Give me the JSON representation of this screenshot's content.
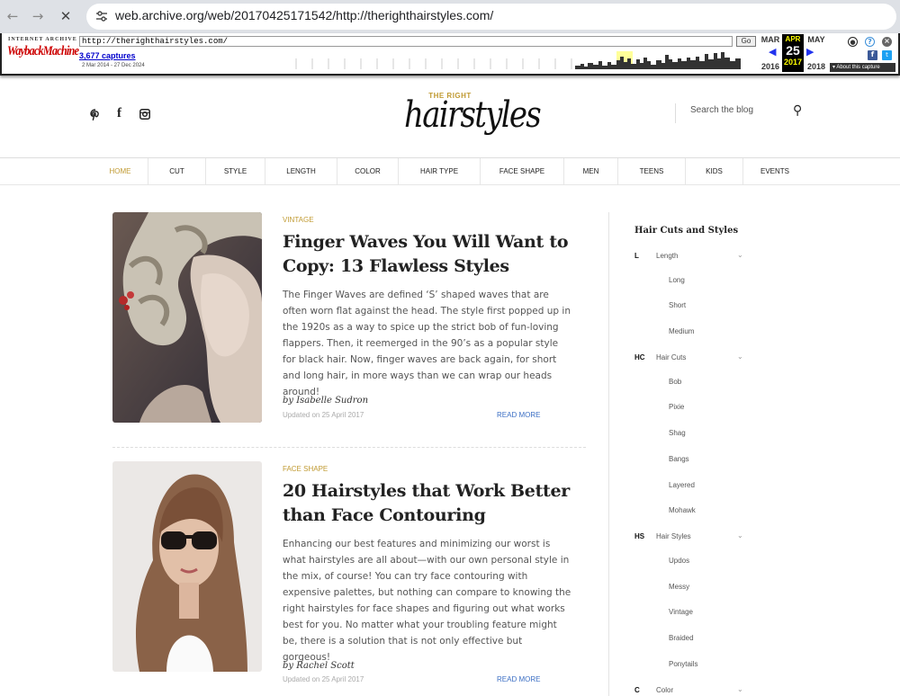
{
  "browser": {
    "url": "web.archive.org/web/20170425171542/http://therighthairstyles.com/"
  },
  "wayback": {
    "ia_label": "INTERNET ARCHIVE",
    "logo": "WaybackMachine",
    "url_value": "http://therighthairstyles.com/",
    "go": "Go",
    "captures": "3,677 captures",
    "range": "2 Mar 2014 - 27 Dec 2024",
    "prev_month": "MAR",
    "cur_month": "APR",
    "next_month": "MAY",
    "cur_day": "25",
    "prev_year": "2016",
    "cur_year": "2017",
    "next_year": "2018",
    "about": "▾ About this capture"
  },
  "site": {
    "brand_top": "THE RIGHT",
    "brand_main": "hairstyles",
    "search_placeholder": "Search the blog"
  },
  "nav": [
    "HOME",
    "CUT",
    "STYLE",
    "LENGTH",
    "COLOR",
    "HAIR TYPE",
    "FACE SHAPE",
    "MEN",
    "TEENS",
    "KIDS",
    "EVENTS"
  ],
  "posts": [
    {
      "category": "VINTAGE",
      "title": "Finger Waves You Will Want to Copy: 13 Flawless Styles",
      "excerpt": "The Finger Waves are defined ‘S’ shaped waves that are often worn flat against the head. The style first popped up in the 1920s as a way to spice up the strict bob of fun-loving flappers. Then, it reemerged in the 90’s as a popular style for black hair. Now, finger waves are back again, for short and long hair, in more ways than we can wrap our heads around!",
      "author": "by Isabelle Sudron",
      "updated": "Updated on 25 April 2017",
      "read_more": "READ MORE"
    },
    {
      "category": "FACE SHAPE",
      "title": "20 Hairstyles that Work Better than Face Contouring",
      "excerpt": "Enhancing our best features and minimizing our worst is what hairstyles are all about—with our own personal style in the mix, of course! You can try face contouring with expensive palettes, but nothing can compare to knowing the right hairstyles for face shapes and figuring out what works best for you. No matter what your troubling feature might be, there is a solution that is not only effective but gorgeous!",
      "author": "by Rachel Scott",
      "updated": "Updated on 25 April 2017",
      "read_more": "READ MORE"
    }
  ],
  "sidebar": {
    "heading": "Hair Cuts and Styles",
    "groups": [
      {
        "abbr": "L",
        "label": "Length",
        "items": [
          "Long",
          "Short",
          "Medium"
        ]
      },
      {
        "abbr": "HC",
        "label": "Hair Cuts",
        "items": [
          "Bob",
          "Pixie",
          "Shag",
          "Bangs",
          "Layered",
          "Mohawk"
        ]
      },
      {
        "abbr": "HS",
        "label": "Hair Styles",
        "items": [
          "Updos",
          "Messy",
          "Vintage",
          "Braided",
          "Ponytails"
        ]
      },
      {
        "abbr": "C",
        "label": "Color",
        "items": []
      }
    ]
  }
}
